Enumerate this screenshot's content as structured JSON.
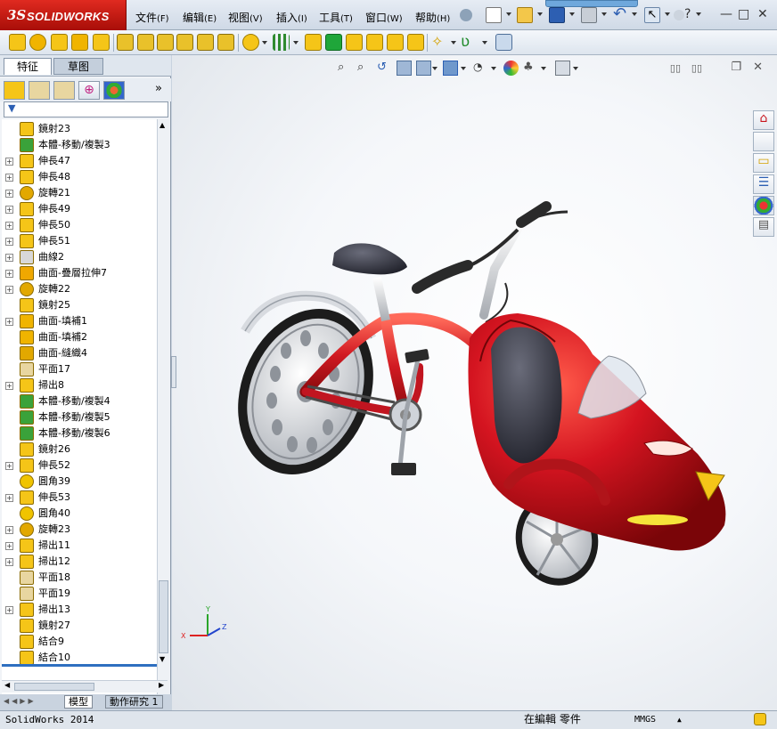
{
  "app": {
    "logo_ds": "3S",
    "logo_name": "SOLIDWORKS"
  },
  "menu": [
    {
      "label": "文件",
      "acc": "(F)"
    },
    {
      "label": "编辑",
      "acc": "(E)"
    },
    {
      "label": "视图",
      "acc": "(V)"
    },
    {
      "label": "插入",
      "acc": "(I)"
    },
    {
      "label": "工具",
      "acc": "(T)"
    },
    {
      "label": "窗口",
      "acc": "(W)"
    },
    {
      "label": "帮助",
      "acc": "(H)"
    }
  ],
  "panel_tabs": {
    "features": "特征",
    "sketch": "草图"
  },
  "manager_icons": [
    "feature-manager-icon",
    "property-manager-icon",
    "configuration-manager-icon",
    "dimxpert-icon",
    "display-manager-icon"
  ],
  "tree_items": [
    {
      "label": "鏡射23",
      "icon": "mirror",
      "expand": false
    },
    {
      "label": "本體-移動/複製3",
      "icon": "move",
      "expand": false
    },
    {
      "label": "伸長47",
      "icon": "extrude",
      "expand": true
    },
    {
      "label": "伸長48",
      "icon": "extrude",
      "expand": true
    },
    {
      "label": "旋轉21",
      "icon": "revolve",
      "expand": true
    },
    {
      "label": "伸長49",
      "icon": "extrude",
      "expand": true
    },
    {
      "label": "伸長50",
      "icon": "extrude",
      "expand": true
    },
    {
      "label": "伸長51",
      "icon": "extrude",
      "expand": true
    },
    {
      "label": "曲線2",
      "icon": "curve",
      "expand": true
    },
    {
      "label": "曲面-疊層拉伸7",
      "icon": "loft",
      "expand": true
    },
    {
      "label": "旋轉22",
      "icon": "revolve",
      "expand": true
    },
    {
      "label": "鏡射25",
      "icon": "mirror",
      "expand": false
    },
    {
      "label": "曲面-填補1",
      "icon": "fill",
      "expand": true
    },
    {
      "label": "曲面-填補2",
      "icon": "fill",
      "expand": false
    },
    {
      "label": "曲面-縫織4",
      "icon": "knit",
      "expand": false
    },
    {
      "label": "平面17",
      "icon": "plane",
      "expand": false
    },
    {
      "label": "掃出8",
      "icon": "sweep",
      "expand": true
    },
    {
      "label": "本體-移動/複製4",
      "icon": "move",
      "expand": false
    },
    {
      "label": "本體-移動/複製5",
      "icon": "move",
      "expand": false
    },
    {
      "label": "本體-移動/複製6",
      "icon": "move",
      "expand": false
    },
    {
      "label": "鏡射26",
      "icon": "mirror",
      "expand": false
    },
    {
      "label": "伸長52",
      "icon": "extrude",
      "expand": true
    },
    {
      "label": "圓角39",
      "icon": "fillet",
      "expand": false
    },
    {
      "label": "伸長53",
      "icon": "extrude",
      "expand": true
    },
    {
      "label": "圓角40",
      "icon": "fillet",
      "expand": false
    },
    {
      "label": "旋轉23",
      "icon": "revolve",
      "expand": true
    },
    {
      "label": "掃出11",
      "icon": "sweep",
      "expand": true
    },
    {
      "label": "掃出12",
      "icon": "sweep",
      "expand": true
    },
    {
      "label": "平面18",
      "icon": "plane",
      "expand": false
    },
    {
      "label": "平面19",
      "icon": "plane",
      "expand": false
    },
    {
      "label": "掃出13",
      "icon": "sweep",
      "expand": true
    },
    {
      "label": "鏡射27",
      "icon": "mirror",
      "expand": false
    },
    {
      "label": "結合9",
      "icon": "combine",
      "expand": false
    },
    {
      "label": "結合10",
      "icon": "combine",
      "expand": false
    }
  ],
  "bottom_tabs": {
    "model": "模型",
    "motion": "動作研究 1"
  },
  "status": {
    "app_version": "SolidWorks 2014",
    "mode": "在編輯 零件",
    "units": "MMGS"
  },
  "triad": {
    "x": "X",
    "y": "Y",
    "z": "Z"
  },
  "colors": {
    "brand_red": "#d2231a",
    "bike_red": "#c8141c",
    "toolbar_yellow": "#f5c518"
  }
}
